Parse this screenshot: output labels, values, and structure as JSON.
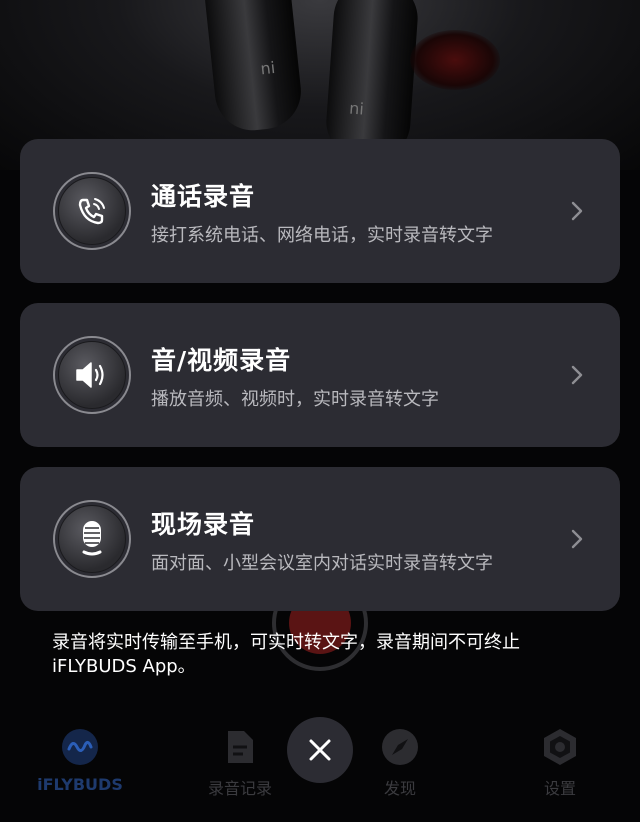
{
  "background": {
    "earbud_logo": "ni"
  },
  "options": [
    {
      "title": "通话录音",
      "description": "接打系统电话、网络电话，实时录音转文字",
      "icon": "phone-call-icon"
    },
    {
      "title": "音/视频录音",
      "description": "播放音频、视频时，实时录音转文字",
      "icon": "speaker-icon"
    },
    {
      "title": "现场录音",
      "description": "面对面、小型会议室内对话实时录音转文字",
      "icon": "microphone-icon"
    }
  ],
  "notice": {
    "line1": "录音将实时传输至手机，可实时转文字，录音期间不可终止",
    "line2": "iFLYBUDS App。"
  },
  "nav": {
    "items": [
      {
        "label": "iFLYBUDS",
        "icon": "iflybuds-wave-icon",
        "active": true
      },
      {
        "label": "录音记录",
        "icon": "document-icon",
        "active": false
      },
      {
        "label": "发现",
        "icon": "compass-icon",
        "active": false
      },
      {
        "label": "设置",
        "icon": "hexagon-gear-icon",
        "active": false
      }
    ],
    "close_icon": "close-icon"
  },
  "colors": {
    "card_bg": "#2c2c33",
    "title_text": "#ffffff",
    "desc_text": "#b9b9be",
    "nav_active": "#1e3a6e"
  }
}
